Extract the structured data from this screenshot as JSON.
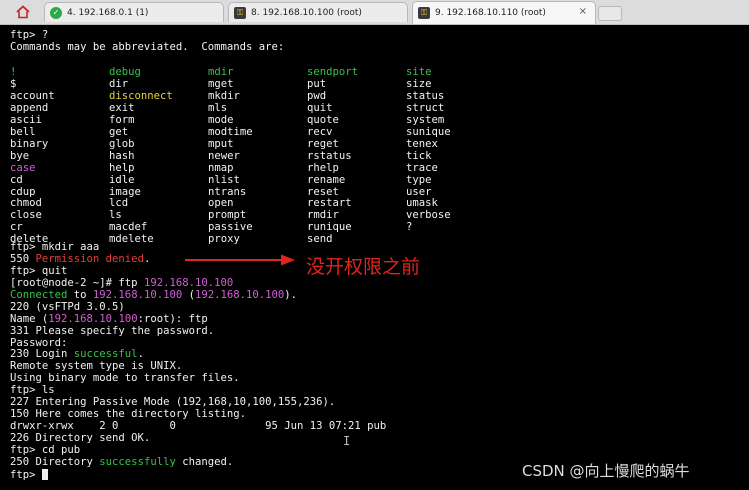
{
  "tabs": [
    {
      "label": "4. 192.168.0.1 (1)",
      "icon": "green-check-icon",
      "active": false
    },
    {
      "label": "8. 192.168.10.100 (root)",
      "icon": "key-icon",
      "active": false
    },
    {
      "label": "9. 192.168.10.110 (root)",
      "icon": "key-icon",
      "active": true
    }
  ],
  "tab_close": "×",
  "colors": {
    "prompt": "#f2f2f2",
    "green": "#35c24a",
    "red": "#e0403a",
    "magenta": "#d35fd3",
    "yellow": "#e3d23c",
    "cyan": "#3fd8d8",
    "background": "#000000"
  },
  "terminal": {
    "header": [
      [
        {
          "t": "ftp> ?"
        }
      ],
      [
        {
          "t": "Commands may be abbreviated.  Commands are:"
        }
      ]
    ],
    "command_columns": [
      [
        {
          "t": "!",
          "c": "g"
        },
        {
          "t": "$"
        },
        {
          "t": "account"
        },
        {
          "t": "append"
        },
        {
          "t": "ascii"
        },
        {
          "t": "bell"
        },
        {
          "t": "binary"
        },
        {
          "t": "bye"
        },
        {
          "t": "case",
          "c": "m"
        },
        {
          "t": "cd"
        },
        {
          "t": "cdup"
        },
        {
          "t": "chmod"
        },
        {
          "t": "close"
        },
        {
          "t": "cr"
        },
        {
          "t": "delete"
        }
      ],
      [
        {
          "t": "debug",
          "c": "g"
        },
        {
          "t": "dir"
        },
        {
          "t": "disconnect",
          "c": "y"
        },
        {
          "t": "exit"
        },
        {
          "t": "form"
        },
        {
          "t": "get"
        },
        {
          "t": "glob"
        },
        {
          "t": "hash"
        },
        {
          "t": "help"
        },
        {
          "t": "idle"
        },
        {
          "t": "image"
        },
        {
          "t": "lcd"
        },
        {
          "t": "ls"
        },
        {
          "t": "macdef"
        },
        {
          "t": "mdelete"
        }
      ],
      [
        {
          "t": "mdir",
          "c": "g"
        },
        {
          "t": "mget"
        },
        {
          "t": "mkdir"
        },
        {
          "t": "mls"
        },
        {
          "t": "mode"
        },
        {
          "t": "modtime"
        },
        {
          "t": "mput"
        },
        {
          "t": "newer"
        },
        {
          "t": "nmap"
        },
        {
          "t": "nlist"
        },
        {
          "t": "ntrans"
        },
        {
          "t": "open"
        },
        {
          "t": "prompt"
        },
        {
          "t": "passive"
        },
        {
          "t": "proxy"
        }
      ],
      [
        {
          "t": "sendport",
          "c": "g"
        },
        {
          "t": "put"
        },
        {
          "t": "pwd"
        },
        {
          "t": "quit"
        },
        {
          "t": "quote"
        },
        {
          "t": "recv"
        },
        {
          "t": "reget"
        },
        {
          "t": "rstatus"
        },
        {
          "t": "rhelp"
        },
        {
          "t": "rename"
        },
        {
          "t": "reset"
        },
        {
          "t": "restart"
        },
        {
          "t": "rmdir"
        },
        {
          "t": "runique"
        },
        {
          "t": "send"
        }
      ],
      [
        {
          "t": "site",
          "c": "g"
        },
        {
          "t": "size"
        },
        {
          "t": "status"
        },
        {
          "t": "struct"
        },
        {
          "t": "system"
        },
        {
          "t": "sunique"
        },
        {
          "t": "tenex"
        },
        {
          "t": "tick"
        },
        {
          "t": "trace"
        },
        {
          "t": "type"
        },
        {
          "t": "user"
        },
        {
          "t": "umask"
        },
        {
          "t": "verbose"
        },
        {
          "t": "?"
        }
      ]
    ],
    "body": [
      [
        {
          "t": "ftp> mkdir aaa"
        }
      ],
      [
        {
          "t": "550 "
        },
        {
          "t": "Permission denied",
          "c": "r"
        },
        {
          "t": "."
        }
      ],
      [
        {
          "t": "ftp> quit"
        }
      ],
      [
        {
          "t": "[root@node-2 ~]# ftp "
        },
        {
          "t": "192.168.10.100",
          "c": "m"
        }
      ],
      [
        {
          "t": "Connected",
          "c": "g"
        },
        {
          "t": " to "
        },
        {
          "t": "192.168.10.100",
          "c": "m"
        },
        {
          "t": " ("
        },
        {
          "t": "192.168.10.100",
          "c": "m"
        },
        {
          "t": ")."
        }
      ],
      [
        {
          "t": "220 (vsFTPd 3.0.5)"
        }
      ],
      [
        {
          "t": "Name ("
        },
        {
          "t": "192.168.10.100",
          "c": "m"
        },
        {
          "t": ":root): ftp"
        }
      ],
      [
        {
          "t": "331 Please specify the password."
        }
      ],
      [
        {
          "t": "Password:"
        }
      ],
      [
        {
          "t": "230 Login "
        },
        {
          "t": "successful",
          "c": "g"
        },
        {
          "t": "."
        }
      ],
      [
        {
          "t": "Remote system type is UNIX."
        }
      ],
      [
        {
          "t": "Using binary mode to transfer files."
        }
      ],
      [
        {
          "t": "ftp> ls"
        }
      ],
      [
        {
          "t": "227 Entering Passive Mode (192,168,10,100,155,236)."
        }
      ],
      [
        {
          "t": "150 Here comes the directory listing."
        }
      ],
      [
        {
          "t": "drwxr-xrwx    2 0        0              95 Jun 13 07:21 pub"
        }
      ],
      [
        {
          "t": "226 Directory send OK."
        }
      ],
      [
        {
          "t": "ftp> cd pub"
        }
      ],
      [
        {
          "t": "250 Directory "
        },
        {
          "t": "successfully",
          "c": "g"
        },
        {
          "t": " changed."
        }
      ],
      [
        {
          "t": "ftp> "
        }
      ]
    ]
  },
  "annotation": "没开权限之前",
  "watermark": "CSDN @向上慢爬的蜗牛"
}
